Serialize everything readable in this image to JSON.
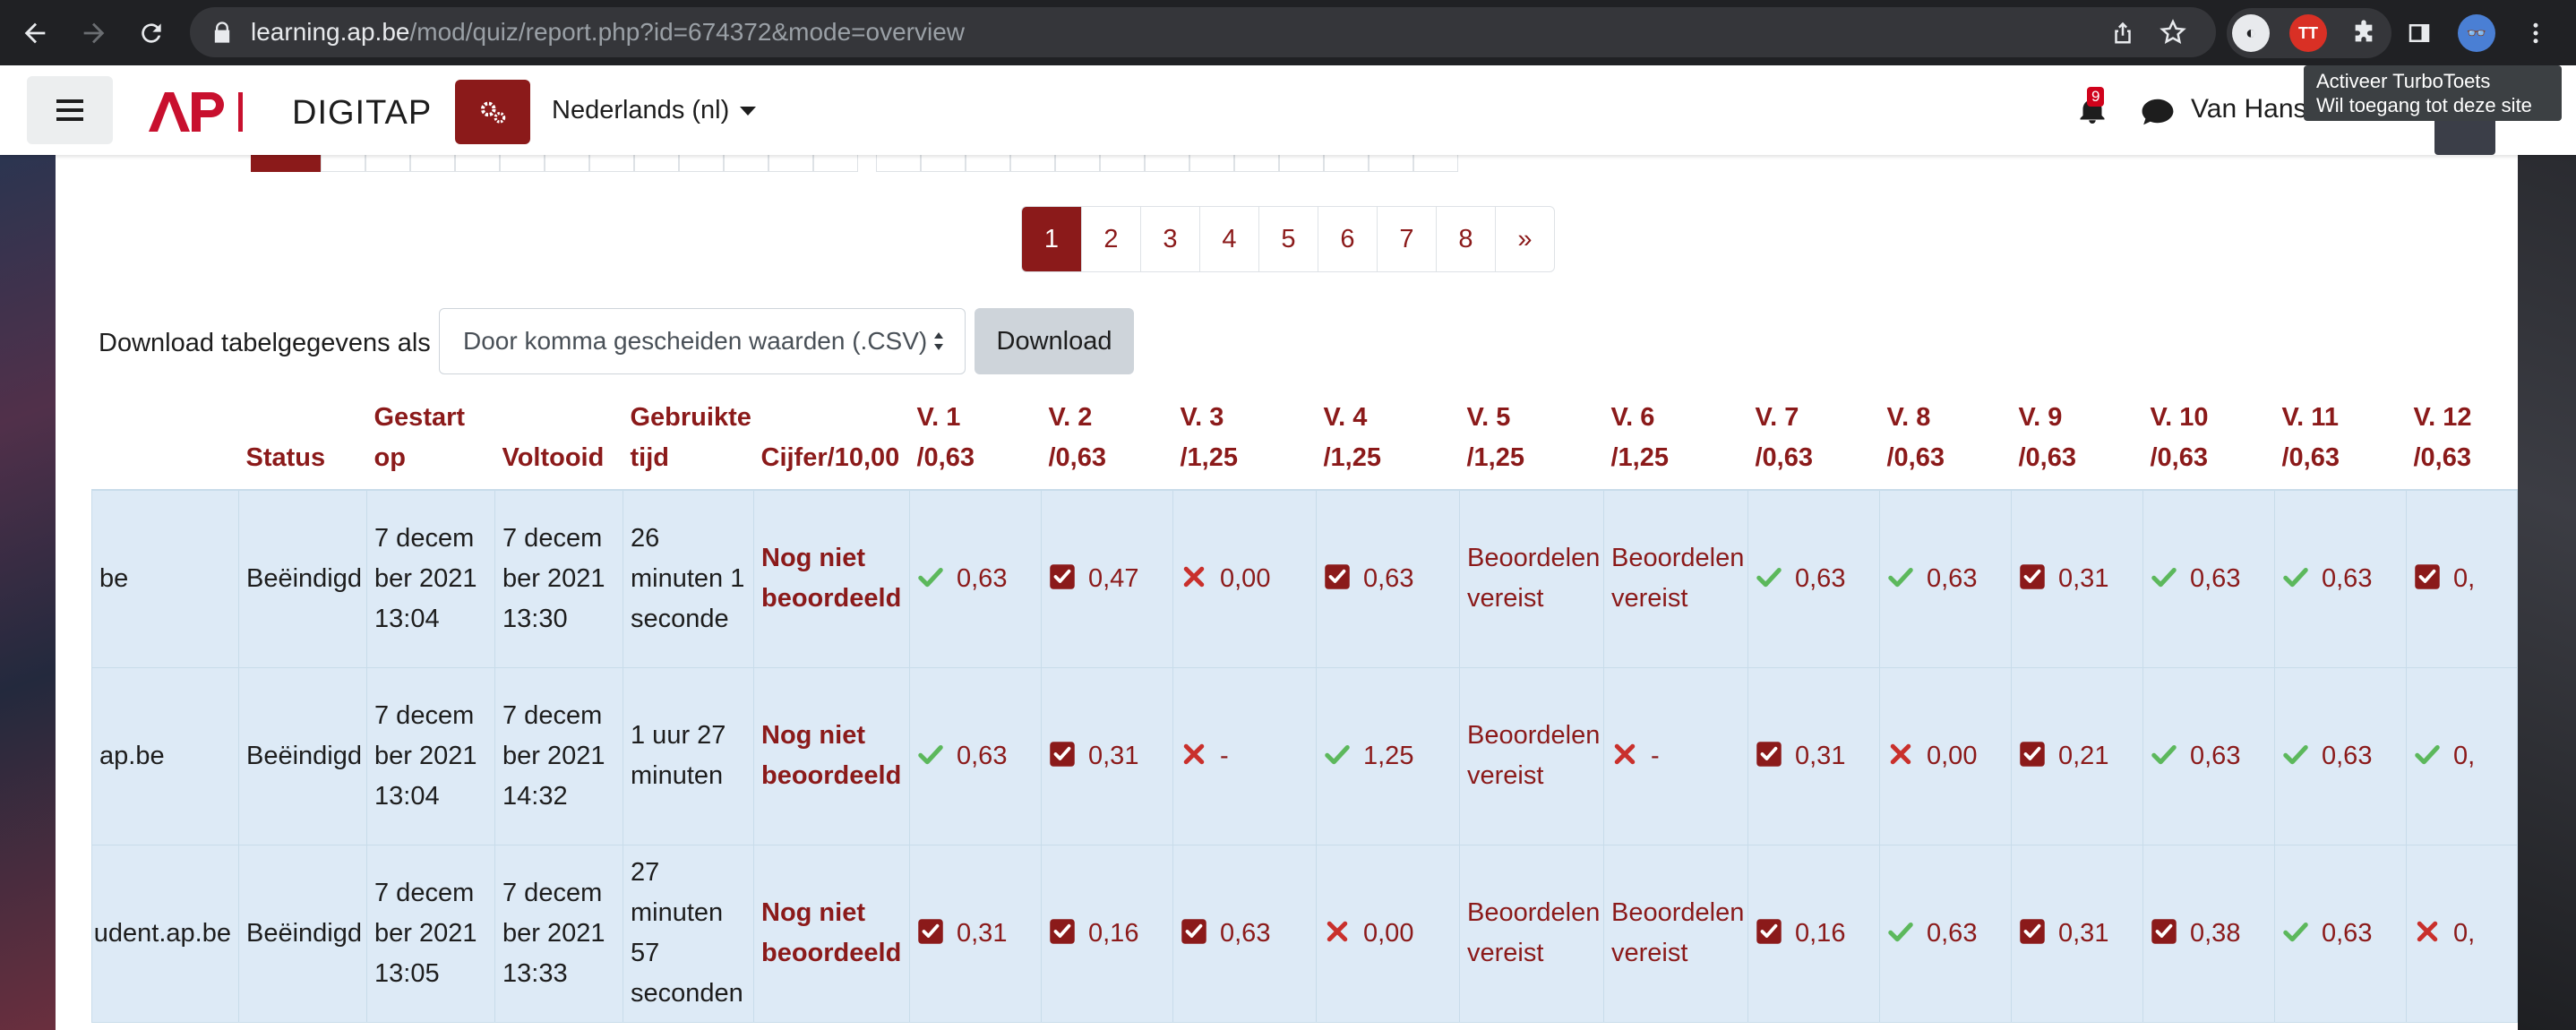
{
  "browser": {
    "url_host": "learning.ap.be",
    "url_path": "/mod/quiz/report.php?id=674372&mode=overview",
    "extension_badge": "TT"
  },
  "tooltip": {
    "line1": "Activeer TurboToets",
    "line2": "Wil toegang tot deze site"
  },
  "header": {
    "site_name": "DIGITAP",
    "language": "Nederlands (nl)",
    "notification_count": "9",
    "user_name": "Van Hanse"
  },
  "pagination": {
    "pages": [
      "1",
      "2",
      "3",
      "4",
      "5",
      "6",
      "7",
      "8"
    ],
    "next": "»",
    "active": "1"
  },
  "download": {
    "label": "Download tabelgegevens als",
    "format": "Door komma gescheiden waarden (.CSV)",
    "button": "Download"
  },
  "table": {
    "headers": [
      {
        "l1": "",
        "l2": ""
      },
      {
        "l1": "",
        "l2": "Status"
      },
      {
        "l1": "Gestart",
        "l2": "op"
      },
      {
        "l1": "",
        "l2": "Voltooid"
      },
      {
        "l1": "Gebruikte",
        "l2": "tijd"
      },
      {
        "l1": "",
        "l2": "Cijfer/10,00"
      },
      {
        "l1": "V. 1",
        "l2": "/0,63"
      },
      {
        "l1": "V. 2",
        "l2": "/0,63"
      },
      {
        "l1": "V. 3",
        "l2": "/1,25"
      },
      {
        "l1": "V. 4",
        "l2": "/1,25"
      },
      {
        "l1": "V. 5",
        "l2": "/1,25"
      },
      {
        "l1": "V. 6",
        "l2": "/1,25"
      },
      {
        "l1": "V. 7",
        "l2": "/0,63"
      },
      {
        "l1": "V. 8",
        "l2": "/0,63"
      },
      {
        "l1": "V. 9",
        "l2": "/0,63"
      },
      {
        "l1": "V. 10",
        "l2": "/0,63"
      },
      {
        "l1": "V. 11",
        "l2": "/0,63"
      },
      {
        "l1": "V. 12",
        "l2": "/0,63"
      }
    ],
    "rows": [
      {
        "email": "be",
        "status": "Beëindigd",
        "started": "7 december 2021 13:04",
        "completed": "7 december 2021 13:30",
        "time": "26 minuten 1 seconde",
        "grade": "Nog niet beoordeeld",
        "q": [
          {
            "icon": "check",
            "val": "0,63"
          },
          {
            "icon": "box",
            "val": "0,47"
          },
          {
            "icon": "cross",
            "val": "0,00"
          },
          {
            "icon": "box",
            "val": "0,63"
          },
          {
            "icon": "",
            "val": "Beoordelen vereist"
          },
          {
            "icon": "",
            "val": "Beoordelen vereist"
          },
          {
            "icon": "check",
            "val": "0,63"
          },
          {
            "icon": "check",
            "val": "0,63"
          },
          {
            "icon": "box",
            "val": "0,31"
          },
          {
            "icon": "check",
            "val": "0,63"
          },
          {
            "icon": "check",
            "val": "0,63"
          },
          {
            "icon": "box",
            "val": "0,"
          }
        ]
      },
      {
        "email": "ap.be",
        "status": "Beëindigd",
        "started": "7 december 2021 13:04",
        "completed": "7 december 2021 14:32",
        "time": "1 uur 27 minuten",
        "grade": "Nog niet beoordeeld",
        "q": [
          {
            "icon": "check",
            "val": "0,63"
          },
          {
            "icon": "box",
            "val": "0,31"
          },
          {
            "icon": "cross",
            "val": "-"
          },
          {
            "icon": "check",
            "val": "1,25"
          },
          {
            "icon": "",
            "val": "Beoordelen vereist"
          },
          {
            "icon": "cross",
            "val": "-"
          },
          {
            "icon": "box",
            "val": "0,31"
          },
          {
            "icon": "cross",
            "val": "0,00"
          },
          {
            "icon": "box",
            "val": "0,21"
          },
          {
            "icon": "check",
            "val": "0,63"
          },
          {
            "icon": "check",
            "val": "0,63"
          },
          {
            "icon": "check",
            "val": "0,"
          }
        ]
      },
      {
        "email": "udent.ap.be",
        "status": "Beëindigd",
        "started": "7 december 2021 13:05",
        "completed": "7 december 2021 13:33",
        "time": "27 minuten 57 seconden",
        "grade": "Nog niet beoordeeld",
        "q": [
          {
            "icon": "box",
            "val": "0,31"
          },
          {
            "icon": "box",
            "val": "0,16"
          },
          {
            "icon": "box",
            "val": "0,63"
          },
          {
            "icon": "cross",
            "val": "0,00"
          },
          {
            "icon": "",
            "val": "Beoordelen vereist"
          },
          {
            "icon": "",
            "val": "Beoordelen vereist"
          },
          {
            "icon": "box",
            "val": "0,16"
          },
          {
            "icon": "check",
            "val": "0,63"
          },
          {
            "icon": "box",
            "val": "0,31"
          },
          {
            "icon": "box",
            "val": "0,38"
          },
          {
            "icon": "check",
            "val": "0,63"
          },
          {
            "icon": "cross",
            "val": "0,"
          }
        ]
      }
    ]
  },
  "colors": {
    "brand": "#8b1a1a",
    "row_bg": "#ddeaf6",
    "check": "#5cb85c",
    "cross": "#c9302c"
  }
}
